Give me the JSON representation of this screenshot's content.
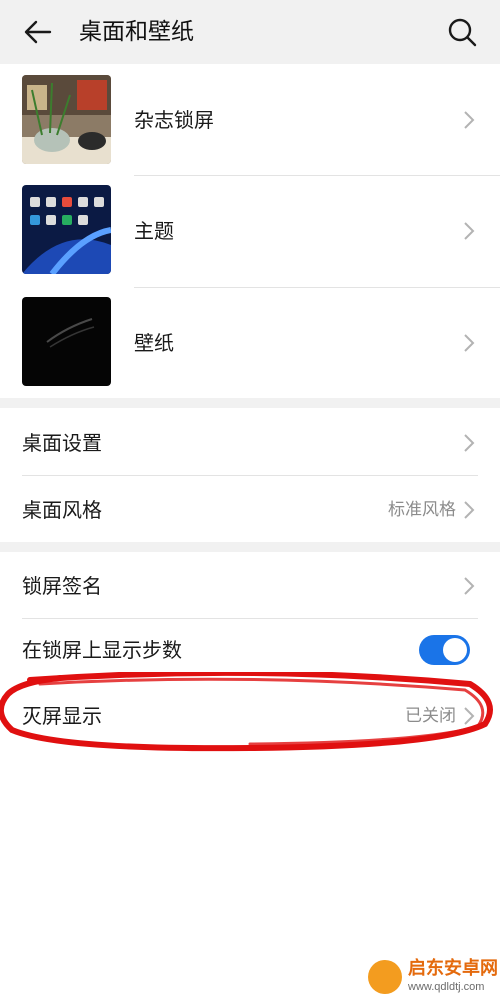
{
  "header": {
    "title": "桌面和壁纸",
    "back_icon": "back-arrow-icon",
    "search_icon": "search-icon"
  },
  "theme_section": {
    "items": [
      {
        "label": "杂志锁屏",
        "thumbnail": "magazine-lockscreen-thumbnail"
      },
      {
        "label": "主题",
        "thumbnail": "theme-thumbnail"
      },
      {
        "label": "壁纸",
        "thumbnail": "wallpaper-thumbnail"
      }
    ]
  },
  "desktop_section": {
    "items": [
      {
        "label": "桌面设置",
        "value": ""
      },
      {
        "label": "桌面风格",
        "value": "标准风格"
      }
    ]
  },
  "lockscreen_section": {
    "items": [
      {
        "label": "锁屏签名"
      },
      {
        "label": "在锁屏上显示步数",
        "toggle_on": true
      },
      {
        "label": "灭屏显示",
        "value": "已关闭"
      }
    ]
  },
  "colors": {
    "accent": "#1a74e8",
    "annotation": "#e01010",
    "section_gap": "#f1f1f1"
  },
  "watermark": {
    "name": "启东安卓网",
    "url": "www.qdldtj.com"
  }
}
